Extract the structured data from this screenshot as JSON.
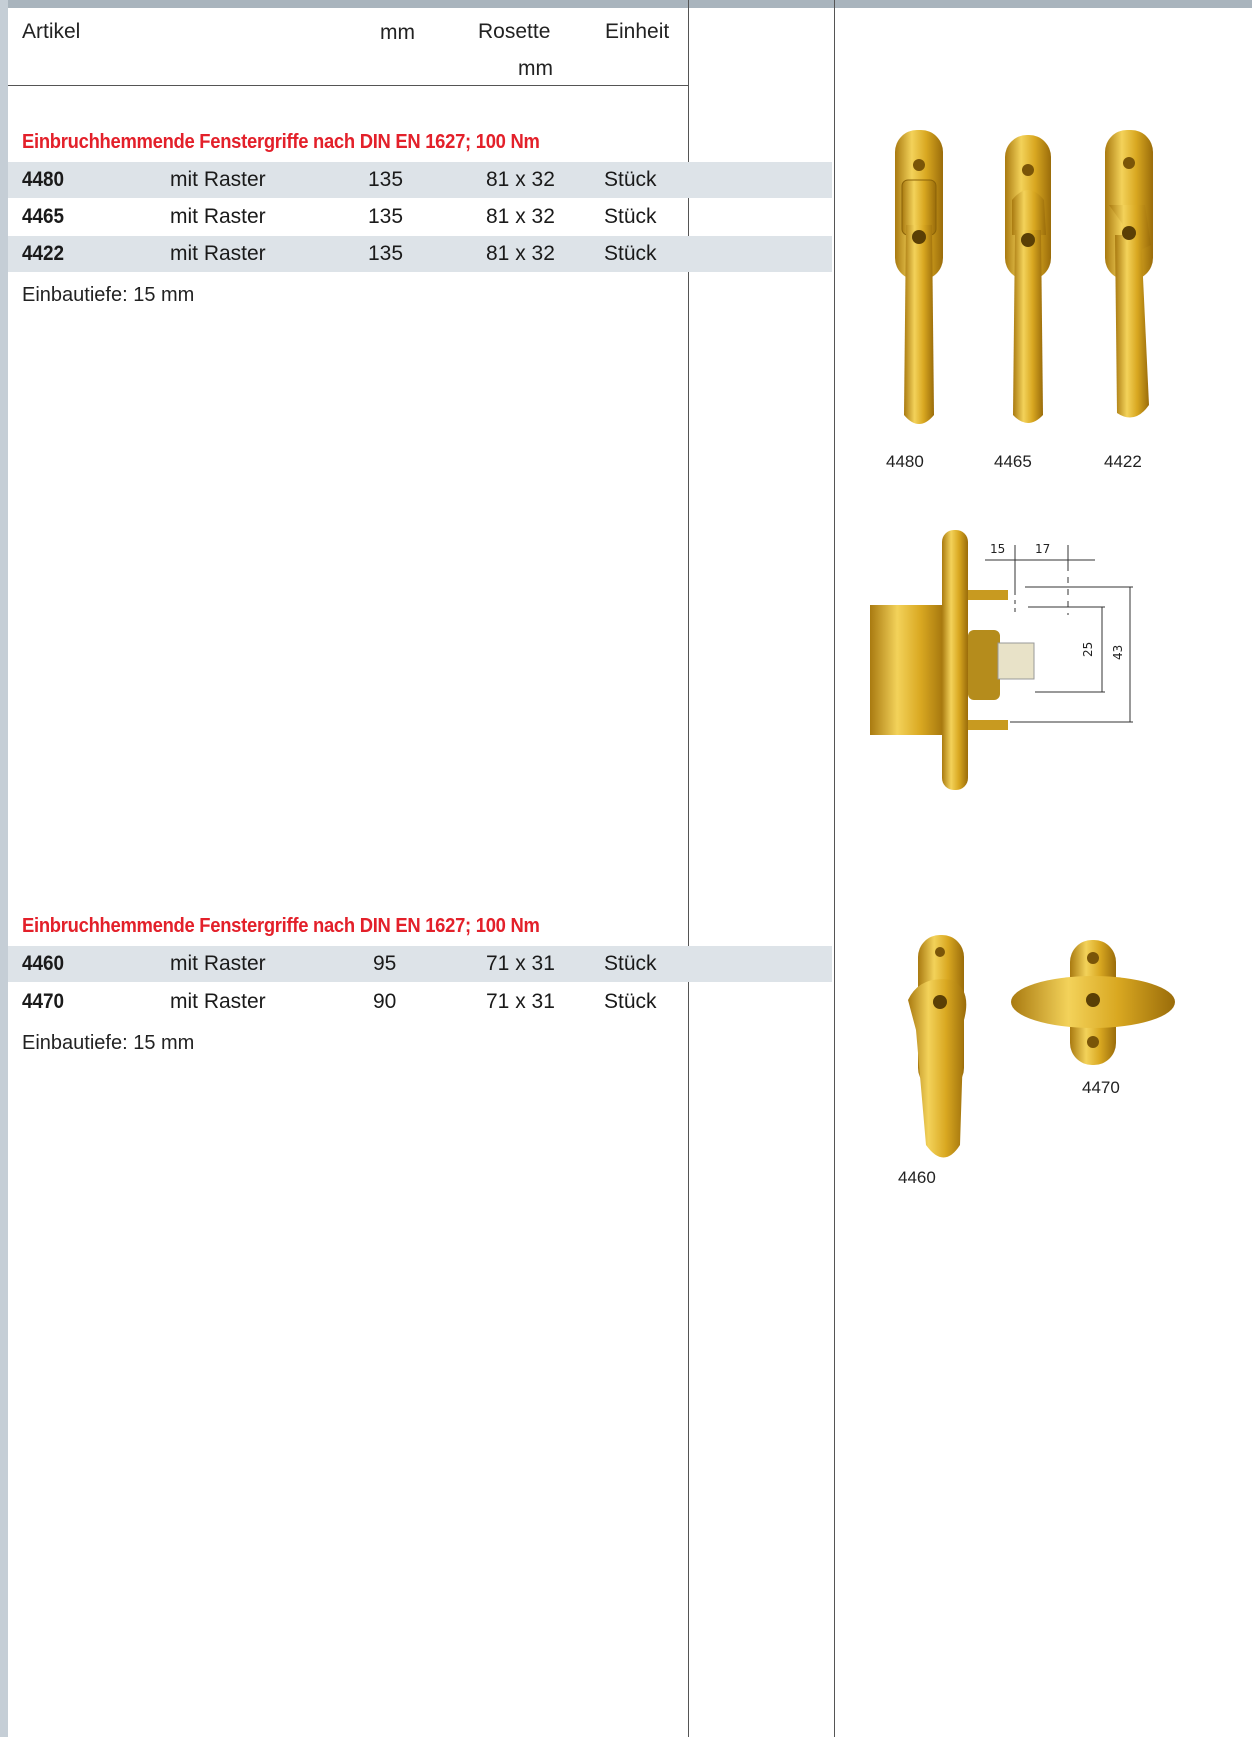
{
  "header": {
    "artikel": "Artikel",
    "mm": "mm",
    "rosette_line1": "Rosette",
    "rosette_line2": "mm",
    "einheit": "Einheit"
  },
  "sections": [
    {
      "title": "Einbruchhemmende Fenstergriffe nach DIN EN 1627; 100 Nm",
      "rows": [
        {
          "artikel": "4480",
          "desc": "mit Raster",
          "mm": "135",
          "rosette": "81 x 32",
          "unit": "Stück"
        },
        {
          "artikel": "4465",
          "desc": "mit Raster",
          "mm": "135",
          "rosette": "81 x 32",
          "unit": "Stück"
        },
        {
          "artikel": "4422",
          "desc": "mit Raster",
          "mm": "135",
          "rosette": "81 x 32",
          "unit": "Stück"
        }
      ],
      "note": "Einbautiefe: 15 mm"
    },
    {
      "title": "Einbruchhemmende Fenstergriffe nach DIN EN 1627; 100 Nm",
      "rows": [
        {
          "artikel": "4460",
          "desc": "mit Raster",
          "mm": "95",
          "rosette": "71 x 31",
          "unit": "Stück"
        },
        {
          "artikel": "4470",
          "desc": "mit Raster",
          "mm": "90",
          "rosette": "71 x 31",
          "unit": "Stück"
        }
      ],
      "note": "Einbautiefe: 15 mm"
    }
  ],
  "images": {
    "captions_top": [
      "4480",
      "4465",
      "4422"
    ],
    "dimension_labels": [
      "15",
      "17",
      "25",
      "43"
    ],
    "caption_4470": "4470",
    "caption_4460": "4460"
  },
  "colors": {
    "accent_red": "#e3202a",
    "row_shade": "#dde3e8",
    "brass": "#d4a82a"
  }
}
